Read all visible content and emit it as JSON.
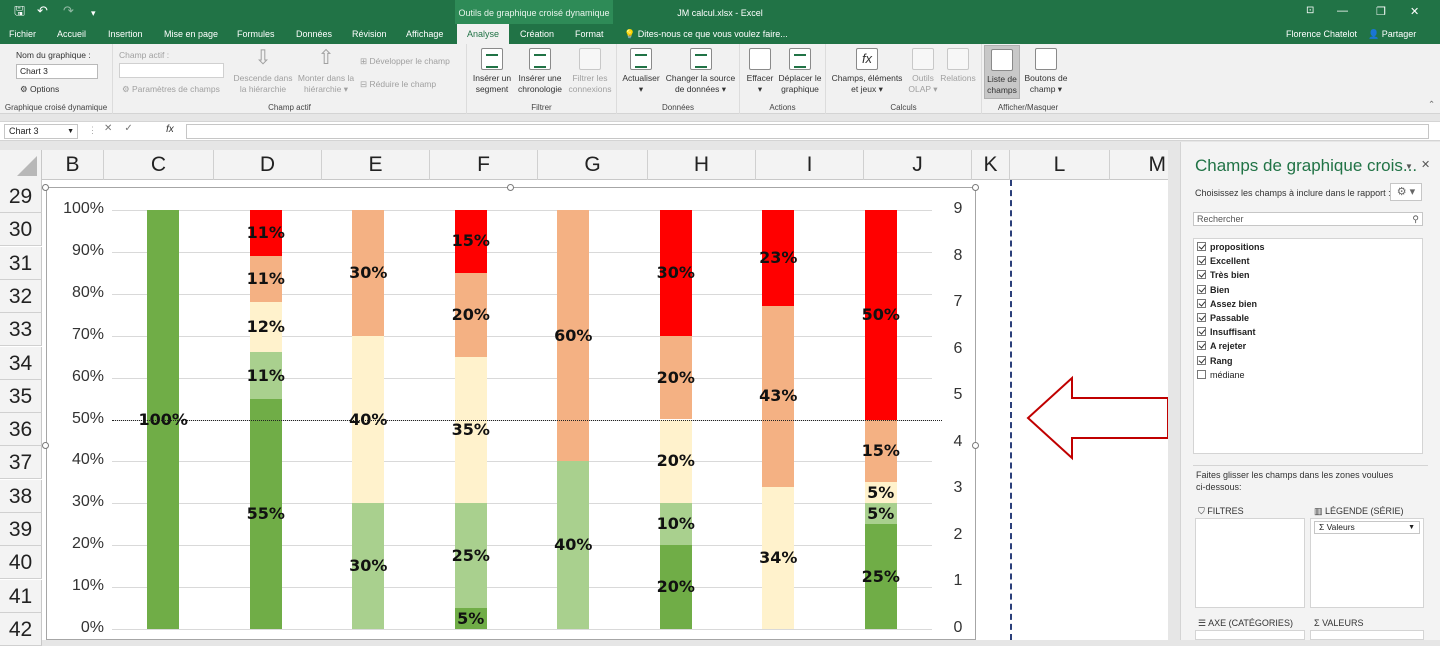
{
  "titlebar": {
    "context_group": "Outils de graphique croisé dynamique",
    "document_title": "JM calcul.xlsx - Excel",
    "window_icons": [
      "save-icon",
      "undo-icon",
      "redo-icon",
      "customize-icon"
    ],
    "window_buttons": [
      "minimize",
      "restore",
      "close"
    ]
  },
  "tabs": [
    "Fichier",
    "Accueil",
    "Insertion",
    "Mise en page",
    "Formules",
    "Données",
    "Révision",
    "Affichage",
    "Analyse",
    "Création",
    "Format"
  ],
  "active_tab": "Analyse",
  "tell_me": "Dites-nous ce que vous voulez faire...",
  "user_name": "Florence Chatelot",
  "share_label": "Partager",
  "ribbon": {
    "chart_name_label": "Nom du graphique :",
    "chart_name_value": "Chart 3",
    "options_label": "Options",
    "group_chart": "Graphique croisé dynamique",
    "active_field_label": "Champ actif :",
    "field_params": "Paramètres de champs",
    "drill_down_1": "Descende dans",
    "drill_down_2": "la hiérarchie",
    "drill_up_1": "Monter dans la",
    "drill_up_2": "hiérarchie",
    "expand_field": "Développer le champ",
    "collapse_field": "Réduire le champ",
    "group_active_field": "Champ actif",
    "insert_slicer_1": "Insérer un",
    "insert_slicer_2": "segment",
    "insert_timeline_1": "Insérer une",
    "insert_timeline_2": "chronologie",
    "filter_conn_1": "Filtrer les",
    "filter_conn_2": "connexions",
    "group_filter": "Filtrer",
    "refresh": "Actualiser",
    "change_source_1": "Changer la source",
    "change_source_2": "de données",
    "group_data": "Données",
    "clear": "Effacer",
    "move_chart_1": "Déplacer le",
    "move_chart_2": "graphique",
    "group_actions": "Actions",
    "fields_items_1": "Champs, éléments",
    "fields_items_2": "et jeux",
    "olap_1": "Outils",
    "olap_2": "OLAP",
    "relations": "Relations",
    "group_calc": "Calculs",
    "field_list_1": "Liste de",
    "field_list_2": "champs",
    "field_buttons_1": "Boutons de",
    "field_buttons_2": "champ",
    "group_show": "Afficher/Masquer"
  },
  "formula_bar": {
    "name_box": "Chart 3",
    "fx": "fx",
    "formula": ""
  },
  "columns": [
    "B",
    "C",
    "D",
    "E",
    "F",
    "G",
    "H",
    "I",
    "J",
    "K",
    "L",
    "M"
  ],
  "rows": [
    "29",
    "30",
    "31",
    "32",
    "33",
    "34",
    "35",
    "36",
    "37",
    "38",
    "39",
    "40",
    "41",
    "42"
  ],
  "pane": {
    "title": "Champs de graphique crois...",
    "choose_fields": "Choisissez les champs à inclure dans le rapport :",
    "search_placeholder": "Rechercher",
    "fields": [
      {
        "name": "propositions",
        "checked": true
      },
      {
        "name": "Excellent",
        "checked": true
      },
      {
        "name": "Très bien",
        "checked": true
      },
      {
        "name": "Bien",
        "checked": true
      },
      {
        "name": "Assez bien",
        "checked": true
      },
      {
        "name": "Passable",
        "checked": true
      },
      {
        "name": "Insuffisant",
        "checked": true
      },
      {
        "name": "A rejeter",
        "checked": true
      },
      {
        "name": "Rang",
        "checked": true
      },
      {
        "name": "médiane",
        "checked": false
      }
    ],
    "drag_text_1": "Faites glisser les champs dans les zones voulues",
    "drag_text_2": "ci-dessous:",
    "zone_filters": "FILTRES",
    "zone_legend": "LÉGENDE (SÉRIE)",
    "zone_legend_item": "Σ Valeurs",
    "zone_axis": "AXE (CATÉGORIES)",
    "zone_values": "VALEURS"
  },
  "colors": {
    "excel_green": "#217346",
    "dark_green": "#70ad47",
    "light_green": "#a9d08e",
    "cream": "#fff2cc",
    "salmon": "#f4b183",
    "red": "#ff0000",
    "arrow": "#c00000"
  },
  "chart_data": {
    "type": "bar",
    "stacked": true,
    "y_axis_labels": [
      "100%",
      "90%",
      "80%",
      "70%",
      "60%",
      "50%",
      "40%",
      "30%",
      "20%",
      "10%",
      "0%"
    ],
    "secondary_axis_labels": [
      "9",
      "8",
      "7",
      "6",
      "5",
      "4",
      "3",
      "2",
      "1",
      "0"
    ],
    "ylim": [
      0,
      100
    ],
    "y2lim": [
      0,
      9
    ],
    "reference_line": 50,
    "grid": true,
    "legend": "none",
    "categories_count": 8,
    "bars": [
      {
        "segments": [
          {
            "value": 100,
            "color": "#70ad47",
            "label": "100%"
          }
        ]
      },
      {
        "segments": [
          {
            "value": 55,
            "color": "#70ad47",
            "label": "55%"
          },
          {
            "value": 11,
            "color": "#a9d08e",
            "label": "11%"
          },
          {
            "value": 12,
            "color": "#fff2cc",
            "label": "12%"
          },
          {
            "value": 11,
            "color": "#f4b183",
            "label": "11%"
          },
          {
            "value": 11,
            "color": "#ff0000",
            "label": "11%"
          }
        ]
      },
      {
        "segments": [
          {
            "value": 30,
            "color": "#a9d08e",
            "label": "30%"
          },
          {
            "value": 40,
            "color": "#fff2cc",
            "label": "40%"
          },
          {
            "value": 30,
            "color": "#f4b183",
            "label": "30%"
          }
        ]
      },
      {
        "segments": [
          {
            "value": 5,
            "color": "#70ad47",
            "label": "5%"
          },
          {
            "value": 25,
            "color": "#a9d08e",
            "label": "25%"
          },
          {
            "value": 35,
            "color": "#fff2cc",
            "label": "35%"
          },
          {
            "value": 20,
            "color": "#f4b183",
            "label": "20%"
          },
          {
            "value": 15,
            "color": "#ff0000",
            "label": "15%"
          }
        ]
      },
      {
        "segments": [
          {
            "value": 40,
            "color": "#a9d08e",
            "label": "40%"
          },
          {
            "value": 60,
            "color": "#f4b183",
            "label": "60%"
          }
        ]
      },
      {
        "segments": [
          {
            "value": 20,
            "color": "#70ad47",
            "label": "20%"
          },
          {
            "value": 10,
            "color": "#a9d08e",
            "label": "10%"
          },
          {
            "value": 20,
            "color": "#fff2cc",
            "label": "20%"
          },
          {
            "value": 20,
            "color": "#f4b183",
            "label": "20%"
          },
          {
            "value": 30,
            "color": "#ff0000",
            "label": "30%"
          }
        ]
      },
      {
        "segments": [
          {
            "value": 34,
            "color": "#fff2cc",
            "label": "34%"
          },
          {
            "value": 43,
            "color": "#f4b183",
            "label": "43%"
          },
          {
            "value": 23,
            "color": "#ff0000",
            "label": "23%"
          }
        ]
      },
      {
        "segments": [
          {
            "value": 25,
            "color": "#70ad47",
            "label": "25%"
          },
          {
            "value": 5,
            "color": "#a9d08e",
            "label": "5%"
          },
          {
            "value": 5,
            "color": "#fff2cc",
            "label": "5%"
          },
          {
            "value": 15,
            "color": "#f4b183",
            "label": "15%"
          },
          {
            "value": 50,
            "color": "#ff0000",
            "label": "50%"
          }
        ]
      }
    ]
  }
}
